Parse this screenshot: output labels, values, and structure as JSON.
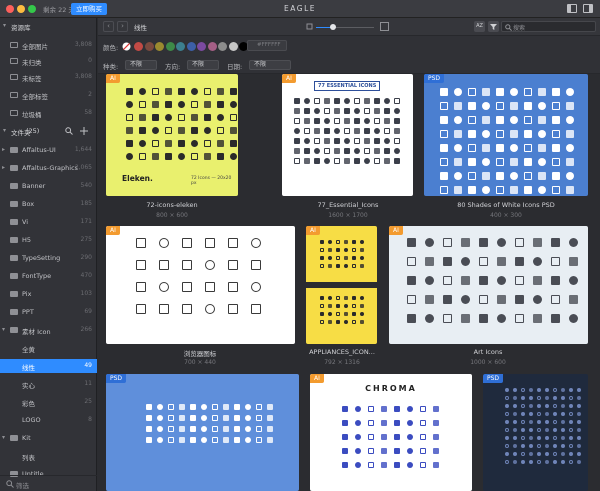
{
  "titlebar": {
    "trial": "剩余 22 天",
    "buy": "立即购买",
    "title": "EAGLE"
  },
  "sidebar": {
    "library_title": "资源库",
    "library_items": [
      {
        "label": "全部图片",
        "count": "3,808"
      },
      {
        "label": "未归类",
        "count": "0"
      },
      {
        "label": "未标签",
        "count": "3,808"
      },
      {
        "label": "全部标签",
        "count": "2"
      },
      {
        "label": "垃圾桶",
        "count": "58"
      }
    ],
    "folders_title": "文件夹",
    "folders_count": "(25)",
    "folders": [
      {
        "label": "Affaltus-UI",
        "count": "1,644"
      },
      {
        "label": "Affaltus-Graphics",
        "count": "2,065"
      },
      {
        "label": "Banner",
        "count": "540"
      },
      {
        "label": "Box",
        "count": "185"
      },
      {
        "label": "Vi",
        "count": "171"
      },
      {
        "label": "H5",
        "count": "275"
      },
      {
        "label": "TypeSetting",
        "count": "290"
      },
      {
        "label": "FontType",
        "count": "470"
      },
      {
        "label": "Pix",
        "count": "103"
      },
      {
        "label": "PPT",
        "count": "69"
      },
      {
        "label": "素材 Icon",
        "count": "266"
      },
      {
        "label": "全黄",
        "count": ""
      },
      {
        "label": "线性",
        "count": "49"
      },
      {
        "label": "实心",
        "count": "11"
      },
      {
        "label": "彩色",
        "count": "25"
      },
      {
        "label": "LOGO",
        "count": "8"
      },
      {
        "label": "Kit",
        "count": ""
      },
      {
        "label": "列表",
        "count": ""
      },
      {
        "label": "Untitle",
        "count": ""
      }
    ],
    "search_placeholder": "筛选"
  },
  "toolbar": {
    "breadcrumb": "线性",
    "zoom": 0.28,
    "sort_label": "AZ",
    "search_placeholder": "搜索"
  },
  "filters": {
    "color_label": "颜色:",
    "hex_placeholder": "#FFFFFF",
    "swatches": [
      "#c14a45",
      "#7a4a3f",
      "#9b8a2f",
      "#3d8a48",
      "#3c7f8f",
      "#3d5fa8",
      "#7b4aa0",
      "#a55f86",
      "#8c8c8c",
      "#c7c7c7",
      "#000000"
    ],
    "type_label": "种类:",
    "type_value": "不限",
    "direction_label": "方向:",
    "direction_value": "不限",
    "date_label": "日期:",
    "date_value": "不限"
  },
  "colors": {
    "accent": "#2f8cff",
    "ai_badge": "#f39b2f",
    "psd_badge": "#2f6fd6"
  },
  "items": [
    {
      "name": "72-icons-eleken",
      "dims": "800 × 600",
      "badge": "AI",
      "bg": "#e9f06e"
    },
    {
      "name": "77_Essential_Icons",
      "dims": "1600 × 1700",
      "badge": "AI",
      "bg": "#ffffff"
    },
    {
      "name": "80 Shades of White Icons PSD",
      "dims": "400 × 300",
      "badge": "PSD",
      "bg": "#4b7fd0"
    },
    {
      "name": "浏览器图标",
      "dims": "700 × 440",
      "badge": "AI",
      "bg": "#ffffff"
    },
    {
      "name": "APPLIANCES_ICON...",
      "dims": "792 × 1316",
      "badge": "AI",
      "bg": "#f7dd45"
    },
    {
      "name": "Art Icons",
      "dims": "1000 × 600",
      "badge": "AI",
      "bg": "#e8eef3"
    },
    {
      "name": "",
      "dims": "",
      "badge": "PSD",
      "bg": "#5f8fdb"
    },
    {
      "name": "",
      "dims": "",
      "badge": "AI",
      "bg": "#ffffff"
    },
    {
      "name": "",
      "dims": "",
      "badge": "PSD",
      "bg": "#1f2a3d"
    }
  ],
  "thumb_text": {
    "eleken_logo": "Eleken.",
    "eleken_note": "72 Icons — 20x20 px",
    "essential_title": "77 ESSENTIAL ICONS",
    "chroma_title": "CHROMA"
  }
}
